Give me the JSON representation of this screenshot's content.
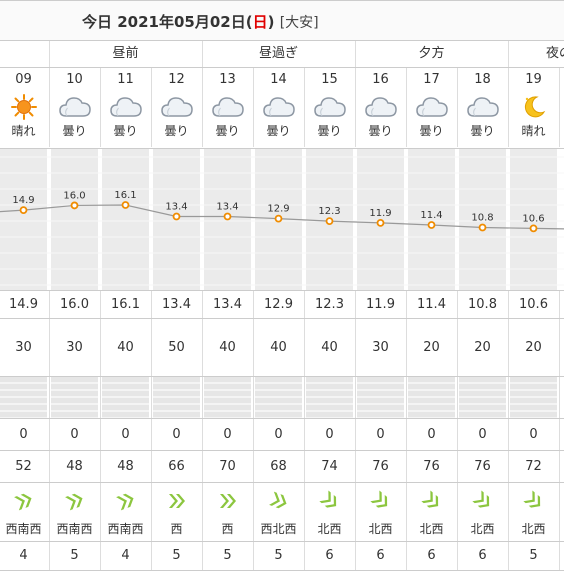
{
  "title": {
    "prefix": "今日 2021年05月02日(",
    "weekday": "日",
    "suffix": ")",
    "rokuyo": "[大安]"
  },
  "periods": [
    {
      "label": ""
    },
    {
      "label": "昼前"
    },
    {
      "label": "昼過ぎ"
    },
    {
      "label": "夕方"
    },
    {
      "label": "夜の"
    }
  ],
  "hours": [
    "09",
    "10",
    "11",
    "12",
    "13",
    "14",
    "15",
    "16",
    "17",
    "18",
    "19"
  ],
  "weather": [
    {
      "icon": "sun-icon",
      "label": "晴れ"
    },
    {
      "icon": "cloud-icon",
      "label": "曇り"
    },
    {
      "icon": "cloud-icon",
      "label": "曇り"
    },
    {
      "icon": "cloud-icon",
      "label": "曇り"
    },
    {
      "icon": "cloud-icon",
      "label": "曇り"
    },
    {
      "icon": "cloud-icon",
      "label": "曇り"
    },
    {
      "icon": "cloud-icon",
      "label": "曇り"
    },
    {
      "icon": "cloud-icon",
      "label": "曇り"
    },
    {
      "icon": "cloud-icon",
      "label": "曇り"
    },
    {
      "icon": "cloud-icon",
      "label": "曇り"
    },
    {
      "icon": "moon-icon",
      "label": "晴れ"
    }
  ],
  "chart_data": {
    "type": "line",
    "x": [
      "09",
      "10",
      "11",
      "12",
      "13",
      "14",
      "15",
      "16",
      "17",
      "18",
      "19"
    ],
    "values": [
      14.9,
      16.0,
      16.1,
      13.4,
      13.4,
      12.9,
      12.3,
      11.9,
      11.4,
      10.8,
      10.6
    ],
    "point_color": "#f08c00",
    "line_color": "#999999"
  },
  "temperature": [
    "14.9",
    "16.0",
    "16.1",
    "13.4",
    "13.4",
    "12.9",
    "12.3",
    "11.9",
    "11.4",
    "10.8",
    "10.6"
  ],
  "precip_prob": [
    "30",
    "30",
    "40",
    "50",
    "40",
    "40",
    "40",
    "30",
    "20",
    "20",
    "20"
  ],
  "precip_amount": [
    "0",
    "0",
    "0",
    "0",
    "0",
    "0",
    "0",
    "0",
    "0",
    "0",
    "0"
  ],
  "humidity": [
    "52",
    "48",
    "48",
    "66",
    "70",
    "68",
    "74",
    "76",
    "76",
    "76",
    "72"
  ],
  "wind_dir": [
    "西南西",
    "西南西",
    "西南西",
    "西",
    "西",
    "西北西",
    "北西",
    "北西",
    "北西",
    "北西",
    "北西"
  ],
  "wind_speed": [
    "4",
    "5",
    "4",
    "5",
    "5",
    "5",
    "6",
    "6",
    "6",
    "6",
    "5"
  ],
  "colors": {
    "sunday": "#e00000",
    "wind_icon": "#8cc63f",
    "gray_band": "#ebebeb"
  }
}
